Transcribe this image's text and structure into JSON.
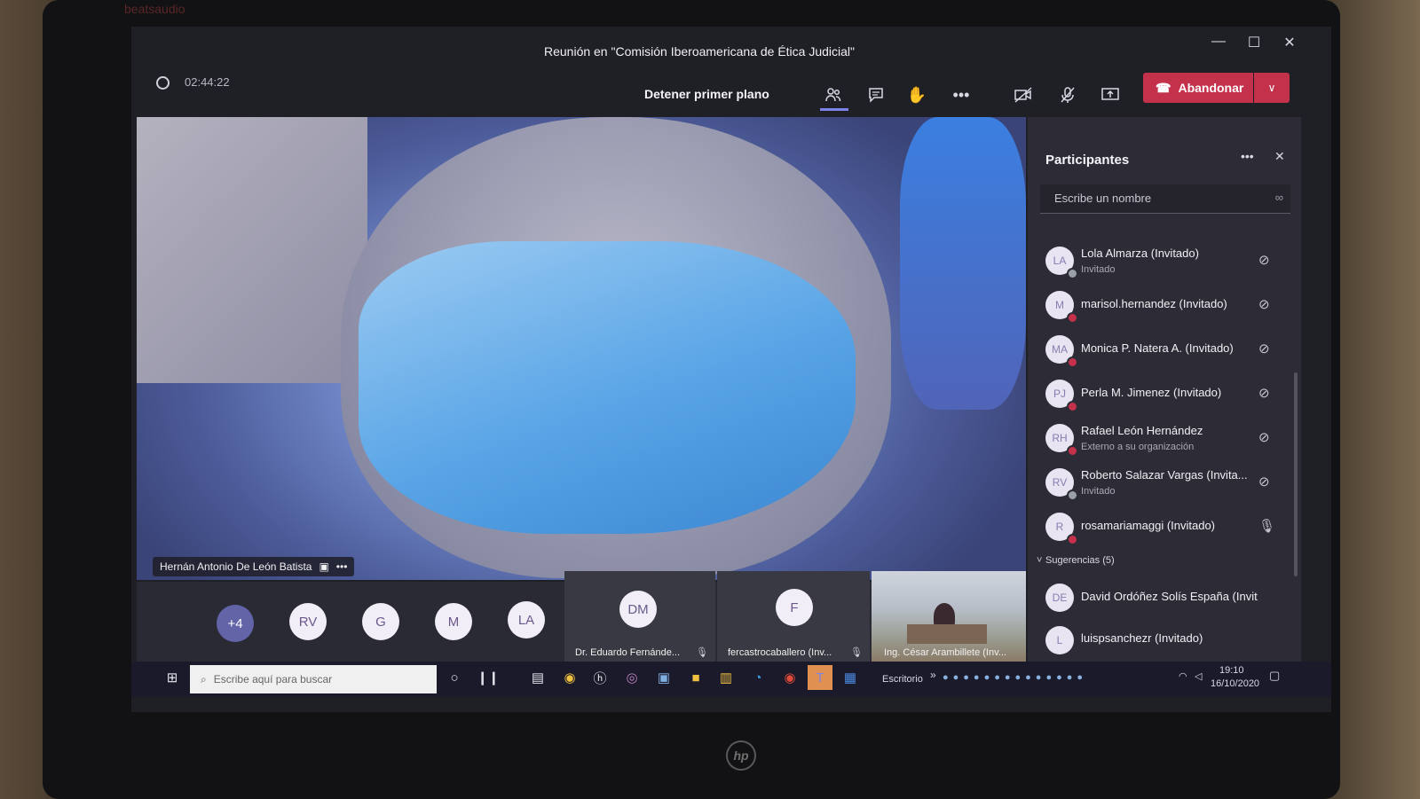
{
  "laptop": {
    "brand": "beatsaudio",
    "logo": "hp"
  },
  "window": {
    "title": "Reunión en \"Comisión Iberoamericana de Ética Judicial\"",
    "controls": [
      "minimize-icon",
      "maximize-icon",
      "close-icon"
    ]
  },
  "toolbar": {
    "timer": "02:44:22",
    "stop_focus": "Detener primer plano",
    "leave_label": "Abandonar",
    "icons": [
      "participants-icon",
      "chat-icon",
      "raise-hand-icon",
      "more-icon",
      "camera-off-icon",
      "mic-off-icon",
      "share-screen-icon"
    ],
    "accent": "#7b83eb",
    "leave_color": "#c4314b"
  },
  "video": {
    "speaker_name": "Hernán Antonio De León Batista"
  },
  "bottom_strip": {
    "avatars": [
      {
        "initials": "+4"
      },
      {
        "initials": "RV"
      },
      {
        "initials": "G"
      },
      {
        "initials": "M"
      },
      {
        "initials": "LA"
      }
    ],
    "tiles": [
      {
        "initials": "DM",
        "name": "Dr. Eduardo Fernánde..."
      },
      {
        "initials": "F",
        "name": "fercastrocaballero (Inv..."
      },
      {
        "initials": "",
        "name": "Ing. César Arambillete (Inv..."
      }
    ]
  },
  "panel": {
    "title": "Participantes",
    "search_placeholder": "Escribe un nombre",
    "participants": [
      {
        "initials": "LA",
        "name": "Lola Almarza (Invitado)",
        "sub": "Invitado",
        "mic": "mic-off-icon"
      },
      {
        "initials": "M",
        "name": "marisol.hernandez (Invitado)",
        "sub": "",
        "mic": "mic-off-icon"
      },
      {
        "initials": "MA",
        "name": "Monica P. Natera A. (Invitado)",
        "sub": "",
        "mic": "mic-off-icon"
      },
      {
        "initials": "PJ",
        "name": "Perla M. Jimenez (Invitado)",
        "sub": "",
        "mic": "mic-off-icon"
      },
      {
        "initials": "RH",
        "name": "Rafael León Hernández",
        "sub": "Externo a su organización",
        "mic": "mic-off-icon"
      },
      {
        "initials": "RV",
        "name": "Roberto Salazar Vargas (Invita...",
        "sub": "Invitado",
        "mic": "mic-off-icon"
      },
      {
        "initials": "R",
        "name": "rosamariamaggi (Invitado)",
        "sub": "",
        "mic": "mic-on-icon"
      }
    ],
    "suggestions_label": "Sugerencias (5)",
    "suggestions": [
      {
        "initials": "DE",
        "name": "David Ordóñez Solís España (Invit..."
      },
      {
        "initials": "L",
        "name": "luispsanchezr (Invitado)"
      }
    ]
  },
  "taskbar": {
    "search_placeholder": "Escribe aquí para buscar",
    "desktop_label": "Escritorio",
    "time": "19:10",
    "date": "16/10/2020"
  }
}
